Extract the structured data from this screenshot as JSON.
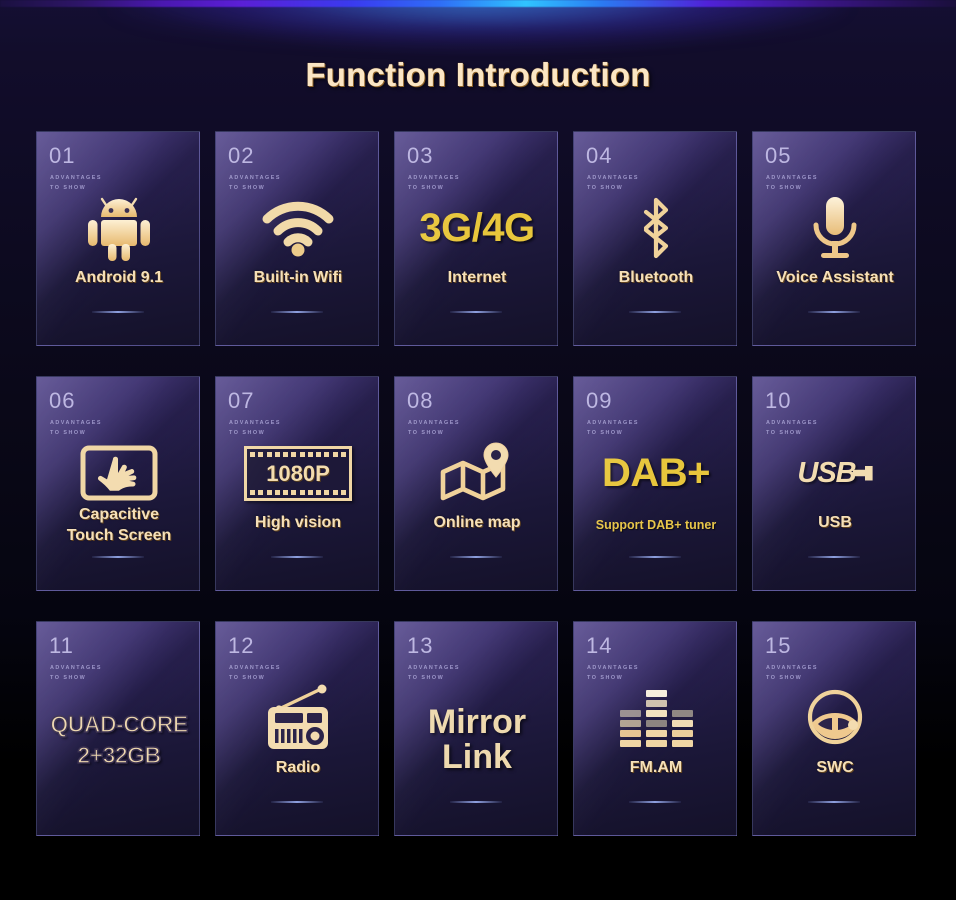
{
  "page": {
    "title": "Function Introduction",
    "card_subtitle_line1": "ADVANTAGES",
    "card_subtitle_line2": "TO SHOW"
  },
  "colors": {
    "gold": "#e8c63c",
    "cream": "#f6e0b8",
    "title": "#fbe6c4",
    "card_number": "#b9b2e0",
    "divider": "#8ea0e0",
    "background": "#0a0818"
  },
  "cards": [
    {
      "number": "01",
      "icon": "android-robot-icon",
      "label": "Android 9.1",
      "label_parts": [
        "Android",
        "9.1"
      ]
    },
    {
      "number": "02",
      "icon": "wifi-icon",
      "label": "Built-in Wifi"
    },
    {
      "number": "03",
      "icon": "3g4g-text-icon",
      "icon_text": "3G/4G",
      "label": "Internet"
    },
    {
      "number": "04",
      "icon": "bluetooth-icon",
      "label": "Bluetooth"
    },
    {
      "number": "05",
      "icon": "microphone-icon",
      "label": "Voice Assistant"
    },
    {
      "number": "06",
      "icon": "touch-screen-hand-icon",
      "label": "Capacitive Touch Screen",
      "label_line1": "Capacitive",
      "label_line2": "Touch Screen"
    },
    {
      "number": "07",
      "icon": "film-strip-1080p-icon",
      "icon_text": "1080P",
      "label": "High vision"
    },
    {
      "number": "08",
      "icon": "map-pin-icon",
      "label": "Online map"
    },
    {
      "number": "09",
      "icon": "dab-plus-text-icon",
      "icon_text": "DAB+",
      "label": "Support DAB+ tuner"
    },
    {
      "number": "10",
      "icon": "usb-logo-icon",
      "icon_text": "USB",
      "label": "USB"
    },
    {
      "number": "11",
      "icon": "quad-core-text-icon",
      "icon_text_line1": "QUAD-CORE",
      "icon_text_line2": "2+32GB",
      "label": ""
    },
    {
      "number": "12",
      "icon": "radio-icon",
      "label": "Radio"
    },
    {
      "number": "13",
      "icon": "mirror-link-text-icon",
      "icon_text_line1": "Mirror",
      "icon_text_line2": "Link",
      "label": ""
    },
    {
      "number": "14",
      "icon": "equalizer-icon",
      "label": "FM.AM"
    },
    {
      "number": "15",
      "icon": "steering-wheel-icon",
      "label": "SWC"
    }
  ]
}
